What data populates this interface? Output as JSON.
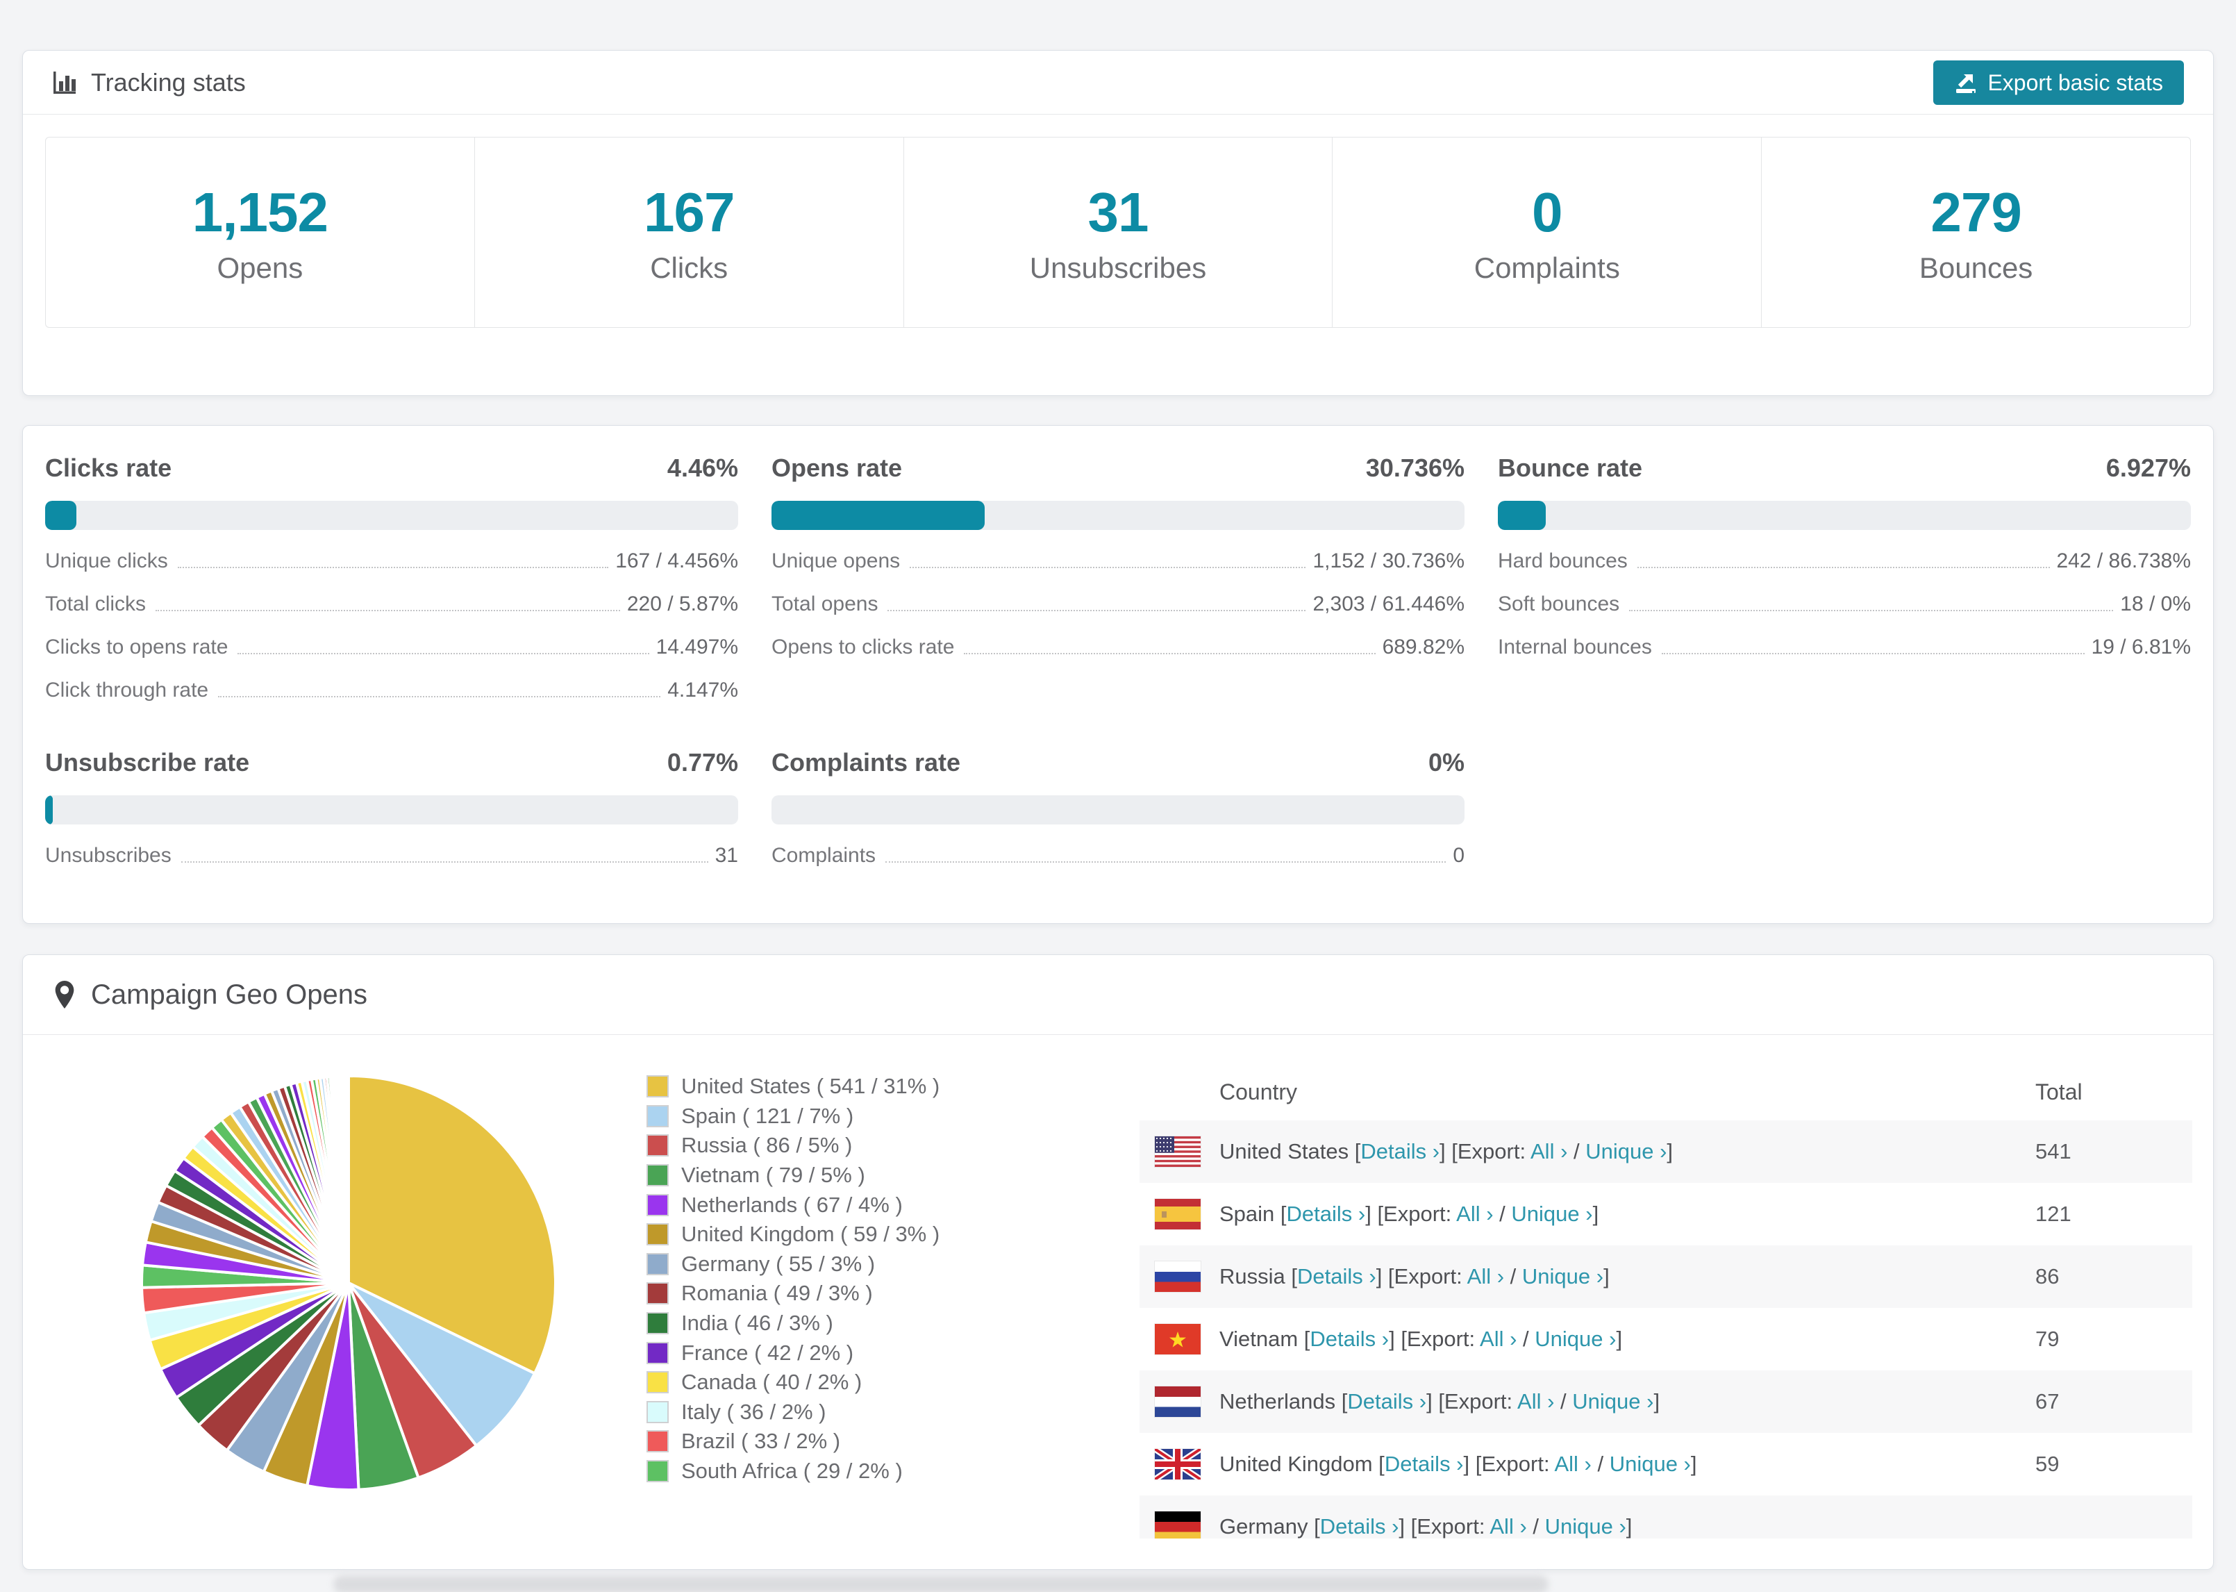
{
  "accent": "#0d8ba4",
  "tracking": {
    "title": "Tracking stats",
    "export_button": "Export basic stats",
    "stats": [
      {
        "value": "1,152",
        "label": "Opens"
      },
      {
        "value": "167",
        "label": "Clicks"
      },
      {
        "value": "31",
        "label": "Unsubscribes"
      },
      {
        "value": "0",
        "label": "Complaints"
      },
      {
        "value": "279",
        "label": "Bounces"
      }
    ]
  },
  "rates": {
    "blocks": [
      {
        "title": "Clicks rate",
        "value": "4.46%",
        "percent": 4.46,
        "rows": [
          {
            "label": "Unique clicks",
            "value": "167 / 4.456%"
          },
          {
            "label": "Total clicks",
            "value": "220 / 5.87%"
          },
          {
            "label": "Clicks to opens rate",
            "value": "14.497%"
          },
          {
            "label": "Click through rate",
            "value": "4.147%"
          }
        ]
      },
      {
        "title": "Opens rate",
        "value": "30.736%",
        "percent": 30.736,
        "rows": [
          {
            "label": "Unique opens",
            "value": "1,152 / 30.736%"
          },
          {
            "label": "Total opens",
            "value": "2,303 / 61.446%"
          },
          {
            "label": "Opens to clicks rate",
            "value": "689.82%"
          }
        ]
      },
      {
        "title": "Bounce rate",
        "value": "6.927%",
        "percent": 6.927,
        "rows": [
          {
            "label": "Hard bounces",
            "value": "242 / 86.738%"
          },
          {
            "label": "Soft bounces",
            "value": "18 / 0%"
          },
          {
            "label": "Internal bounces",
            "value": "19 / 6.81%"
          }
        ]
      },
      {
        "title": "Unsubscribe rate",
        "value": "0.77%",
        "percent": 0.77,
        "rows": [
          {
            "label": "Unsubscribes",
            "value": "31"
          }
        ]
      },
      {
        "title": "Complaints rate",
        "value": "0%",
        "percent": 0,
        "rows": [
          {
            "label": "Complaints",
            "value": "0"
          }
        ]
      }
    ]
  },
  "geo": {
    "title": "Campaign Geo Opens",
    "legend": [
      {
        "label": "United States ( 541 / 31% )",
        "color": "#e7c342"
      },
      {
        "label": "Spain ( 121 / 7% )",
        "color": "#abd3f0"
      },
      {
        "label": "Russia ( 86 / 5% )",
        "color": "#cb4e4e"
      },
      {
        "label": "Vietnam ( 79 / 5% )",
        "color": "#4aa455"
      },
      {
        "label": "Netherlands ( 67 / 4% )",
        "color": "#9a35ee"
      },
      {
        "label": "United Kingdom ( 59 / 3% )",
        "color": "#bf992a"
      },
      {
        "label": "Germany ( 55 / 3% )",
        "color": "#8fabcb"
      },
      {
        "label": "Romania ( 49 / 3% )",
        "color": "#a33b3b"
      },
      {
        "label": "India ( 46 / 3% )",
        "color": "#2f7d3c"
      },
      {
        "label": "France ( 42 / 2% )",
        "color": "#7229c5"
      },
      {
        "label": "Canada ( 40 / 2% )",
        "color": "#f9e145"
      },
      {
        "label": "Italy ( 36 / 2% )",
        "color": "#d9fbfc"
      },
      {
        "label": "Brazil ( 33 / 2% )",
        "color": "#ef5a5a"
      },
      {
        "label": "South Africa ( 29 / 2% )",
        "color": "#5dc163"
      }
    ],
    "table": {
      "columns": [
        "Country",
        "Total"
      ],
      "links": {
        "details": "Details ›",
        "export_prefix": "Export:",
        "all": "All ›",
        "unique": "Unique ›"
      },
      "rows": [
        {
          "country": "United States",
          "flag": "us",
          "total": "541"
        },
        {
          "country": "Spain",
          "flag": "es",
          "total": "121"
        },
        {
          "country": "Russia",
          "flag": "ru",
          "total": "86"
        },
        {
          "country": "Vietnam",
          "flag": "vn",
          "total": "79"
        },
        {
          "country": "Netherlands",
          "flag": "nl",
          "total": "67"
        },
        {
          "country": "United Kingdom",
          "flag": "gb",
          "total": "59"
        },
        {
          "country": "Germany",
          "flag": "de",
          "total": ""
        }
      ]
    }
  },
  "chart_data": {
    "type": "pie",
    "title": "Campaign Geo Opens",
    "legend_position": "right",
    "series": [
      {
        "name": "United States",
        "value": 541,
        "pct": "31%"
      },
      {
        "name": "Spain",
        "value": 121,
        "pct": "7%"
      },
      {
        "name": "Russia",
        "value": 86,
        "pct": "5%"
      },
      {
        "name": "Vietnam",
        "value": 79,
        "pct": "5%"
      },
      {
        "name": "Netherlands",
        "value": 67,
        "pct": "4%"
      },
      {
        "name": "United Kingdom",
        "value": 59,
        "pct": "3%"
      },
      {
        "name": "Germany",
        "value": 55,
        "pct": "3%"
      },
      {
        "name": "Romania",
        "value": 49,
        "pct": "3%"
      },
      {
        "name": "India",
        "value": 46,
        "pct": "3%"
      },
      {
        "name": "France",
        "value": 42,
        "pct": "2%"
      },
      {
        "name": "Canada",
        "value": 40,
        "pct": "2%"
      },
      {
        "name": "Italy",
        "value": 36,
        "pct": "2%"
      },
      {
        "name": "Brazil",
        "value": 33,
        "pct": "2%"
      },
      {
        "name": "South Africa",
        "value": 29,
        "pct": "2%"
      }
    ],
    "colors": [
      "#e7c342",
      "#abd3f0",
      "#cb4e4e",
      "#4aa455",
      "#9a35ee",
      "#bf992a",
      "#8fabcb",
      "#a33b3b",
      "#2f7d3c",
      "#7229c5",
      "#f9e145",
      "#d9fbfc",
      "#ef5a5a",
      "#5dc163"
    ],
    "others_values": [
      30,
      28,
      26,
      24,
      22,
      20,
      19,
      18,
      17,
      16,
      15,
      14,
      13,
      12,
      11,
      10,
      9,
      9,
      8,
      8,
      7,
      7,
      6,
      6,
      5,
      5,
      4,
      4,
      3,
      3,
      3,
      2,
      2,
      2,
      2,
      1,
      1,
      1,
      1,
      1,
      1,
      1
    ]
  }
}
